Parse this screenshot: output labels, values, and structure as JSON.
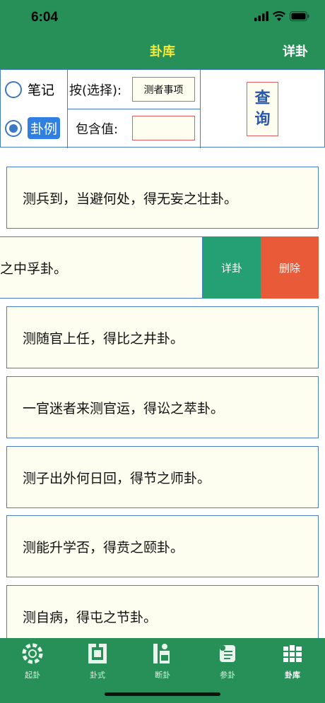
{
  "status_bar": {
    "time": "6:04"
  },
  "nav": {
    "title": "卦库",
    "right_button": "详卦"
  },
  "query_panel": {
    "radio_options": [
      {
        "label": "笔记",
        "selected": false
      },
      {
        "label": "卦例",
        "selected": true
      }
    ],
    "sort_label": "按(选择):",
    "sort_value": "测者事项",
    "contains_label": "包含值:",
    "contains_value": "",
    "query_button": "查询"
  },
  "list": {
    "items": [
      "测兵到，当避何处，得无妄之壮卦。",
      "之中孚卦。",
      "测随官上任，得比之井卦。",
      "一官迷者来测官运，得讼之萃卦。",
      "测子出外何日回，得节之师卦。",
      "测能升学否，得贲之颐卦。",
      "测自病，得屯之节卦。"
    ],
    "swipe_actions": {
      "detail": "详卦",
      "delete": "删除"
    }
  },
  "tabs": [
    {
      "label": "起卦",
      "icon": "dharma-wheel-icon",
      "active": false
    },
    {
      "label": "卦式",
      "icon": "hexagram-layout-icon",
      "active": false
    },
    {
      "label": "断卦",
      "icon": "reading-person-icon",
      "active": false
    },
    {
      "label": "参卦",
      "icon": "scroll-icon",
      "active": false
    },
    {
      "label": "卦库",
      "icon": "bookshelf-icon",
      "active": true
    }
  ],
  "colors": {
    "primary_green": "#269058",
    "title_yellow": "#f4ea3a",
    "card_bg": "#fdfdf0",
    "card_border": "#4a7fbf",
    "detail_button": "#24a074",
    "delete_button": "#e85a38",
    "radio_blue": "#3a78c4"
  }
}
